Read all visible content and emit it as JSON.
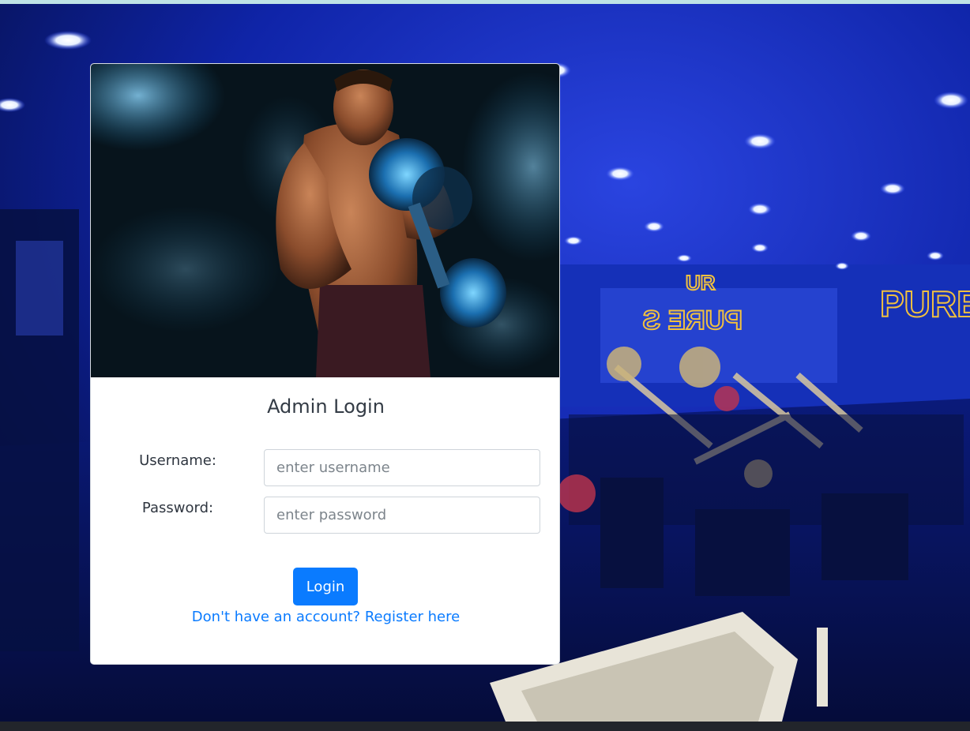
{
  "login": {
    "title": "Admin Login",
    "username_label": "Username:",
    "username_placeholder": "enter username",
    "username_value": "",
    "password_label": "Password:",
    "password_placeholder": "enter password",
    "password_value": "",
    "submit_label": "Login",
    "register_link": "Don't have an account? Register here"
  },
  "background": {
    "sign_text": "PURE S",
    "sign_text_mirrored": "PURE S",
    "sign_partial": "UR"
  },
  "colors": {
    "accent": "#0a7bff",
    "background_blue": "#0b1a6e",
    "card_bg": "#ffffff",
    "sign_gold": "#f0c040"
  }
}
